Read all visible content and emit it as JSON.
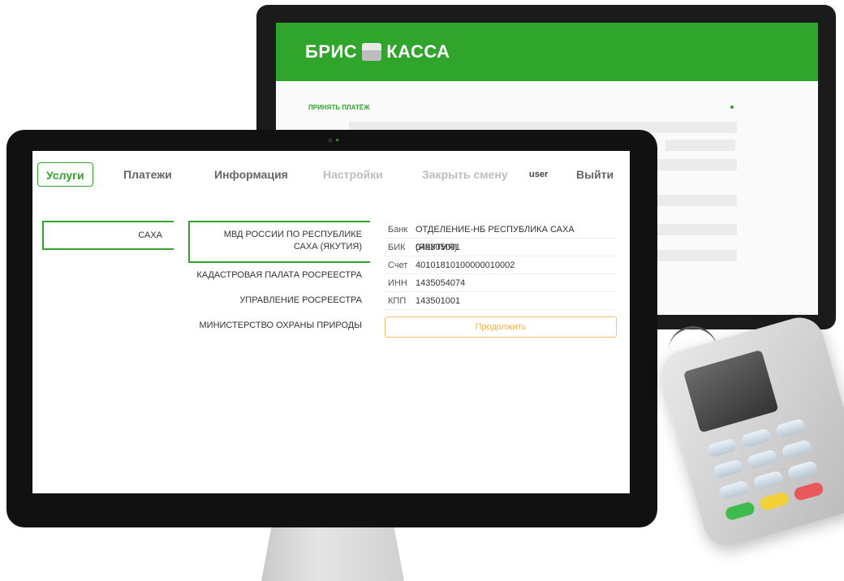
{
  "back_app": {
    "brand_left": "БРИС",
    "brand_right": "КАССА",
    "section_title": "ПРИНЯТЬ ПЛАТЁЖ"
  },
  "nav": {
    "services": "Услуги",
    "payments": "Платежи",
    "info": "Информация",
    "settings": "Настройки",
    "close_shift": "Закрыть смену",
    "user": "user",
    "logout": "Выйти"
  },
  "regions": [
    {
      "label": "САХА"
    }
  ],
  "services": [
    {
      "label": "МВД РОССИИ ПО РЕСПУБЛИКЕ САХА (ЯКУТИЯ)"
    },
    {
      "label": "КАДАСТРОВАЯ ПАЛАТА РОСРЕЕСТРА"
    },
    {
      "label": "УПРАВЛЕНИЕ РОСРЕЕСТРА"
    },
    {
      "label": "МИНИСТЕРСТВО ОХРАНЫ ПРИРОДЫ"
    }
  ],
  "details": {
    "bank_label": "Банк",
    "bank_value": "ОТДЕЛЕНИЕ-НБ РЕСПУБЛИКА САХА (ЯКУТИЯ)",
    "bik_label": "БИК",
    "bik_value": "049805001",
    "account_label": "Счет",
    "account_value": "40101810100000010002",
    "inn_label": "ИНН",
    "inn_value": "1435054074",
    "kpp_label": "КПП",
    "kpp_value": "143501001",
    "continue": "Продолжить"
  },
  "colors": {
    "accent": "#2fa52b",
    "continue_border": "#f5c26b"
  }
}
